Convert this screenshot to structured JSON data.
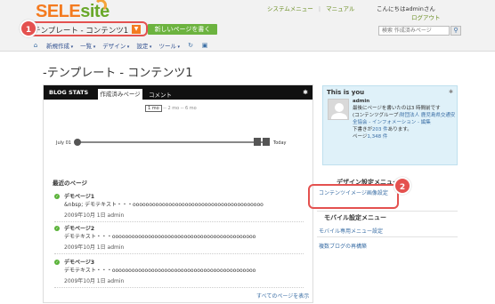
{
  "header": {
    "logo_sele": "SELE",
    "logo_site": "site",
    "nav_system": "システムメニュー",
    "nav_sep": "|",
    "nav_manual": "マニュアル",
    "greeting": "こんにちはadminさん",
    "logout": "ログアウト",
    "crumb_title": "-テンプレート - コンテンツ1",
    "caret": "▼",
    "new_page": "新しいページを書く",
    "search_placeholder": "検索 作成済みページ",
    "search_icon": "magnifier-icon"
  },
  "menu": {
    "items": [
      "新規作成",
      "一覧",
      "デザイン",
      "設定",
      "ツール"
    ]
  },
  "page_title": "-テンプレート - コンテンツ1",
  "blog_stats": {
    "heading": "BLOG STATS",
    "tabs": [
      "作成済みページ",
      "コメント"
    ],
    "periods_on": "1 mo",
    "periods_rest": " -- 2 mo -- 6 mo",
    "start_label": "July 01",
    "end_label": "Today",
    "recent_title": "最近のページ",
    "posts": [
      {
        "title": "デモページ1",
        "body": "&nbsp; デモテキスト・・・oooooooooooooooooooooooooooooooooooooooo",
        "meta": "2009年10月 1日 admin"
      },
      {
        "title": "デモページ2",
        "body": "デモテキスト・・・oooooooooooooooooooooooooooooooooooooooooooo",
        "meta": "2009年10月 1日 admin"
      },
      {
        "title": "デモページ3",
        "body": "デモテキスト・・・oooooooooooooooooooooooooooooooooooooooooooo",
        "meta": "2009年10月 1日 admin"
      }
    ],
    "all_posts": "すべてのページを表示"
  },
  "you": {
    "heading": "This is you",
    "name": "admin",
    "line1": "最後にページを書いたのは3 時間前です",
    "line2": "(コンテンツグループ:",
    "group_link": "財団法人 鹿児島県交通安全協会 - インフォメーション - 編集",
    "line3_pre": "下書きが",
    "line3_link": "203 件",
    "line3_post": "あります。",
    "line4_pre": "ページ",
    "line4_link": "1,348 件"
  },
  "sidebar": {
    "design_head": "デザイン設定メニュー",
    "design_link": "コンテンツイメージ画像設定",
    "mobile_head": "モバイル設定メニュー",
    "mobile_link": "モバイル専用メニュー設定",
    "rebuild_link": "複数ブログの再構築"
  },
  "badges": [
    "1",
    "2"
  ],
  "colors": {
    "accent_orange": "#f47b20",
    "accent_green": "#6cb33f",
    "badge_red": "#e4514f",
    "link_blue": "#3a6ea5"
  }
}
